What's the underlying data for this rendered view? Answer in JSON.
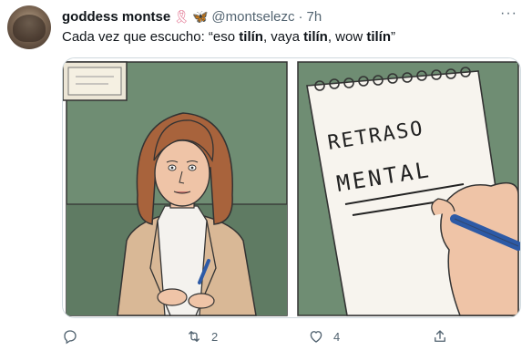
{
  "tweet": {
    "author_name": "goddess montse",
    "handle": "@montselezc",
    "separator": "·",
    "time": "7h",
    "text_parts": [
      {
        "t": "Cada vez que escucho: “eso ",
        "b": false
      },
      {
        "t": "tilín",
        "b": true
      },
      {
        "t": ", vaya ",
        "b": false
      },
      {
        "t": "tilín",
        "b": true
      },
      {
        "t": ", wow ",
        "b": false
      },
      {
        "t": "tilín",
        "b": true
      },
      {
        "t": "”",
        "b": false
      }
    ],
    "more_label": "···",
    "emojis": [
      "ribbon",
      "butterfly"
    ]
  },
  "media": {
    "notepad_line1": "RETRASO",
    "notepad_line2": "MENTAL"
  },
  "actions": {
    "reply_count": "",
    "retweet_count": "2",
    "like_count": "4"
  },
  "colors": {
    "wall": "#6f8d73",
    "suit": "#d9b896",
    "hair": "#a8633c",
    "paper": "#f7f4ee",
    "muted": "#536471"
  }
}
